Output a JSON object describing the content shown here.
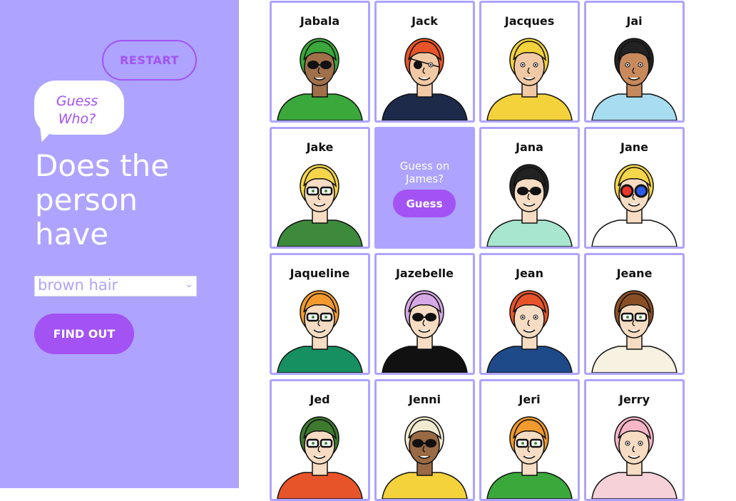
{
  "sidebar": {
    "restart_label": "RESTART",
    "bubble_line1": "Guess",
    "bubble_line2": "Who?",
    "question_line1": "Does the",
    "question_line2": "person",
    "question_line3": "have",
    "select_value": "brown hair",
    "find_out_label": "FIND OUT"
  },
  "colors": {
    "sidebar_bg": "#aea4ff",
    "accent": "#a352f4",
    "card_border": "#aea4ff"
  },
  "guess_card": {
    "line1": "Guess on",
    "line2": "James?",
    "button_label": "Guess"
  },
  "cards": [
    {
      "name": "Jabala",
      "skin": "#a0704a",
      "hair": "#3aa83a",
      "shirt": "#3aa83a",
      "glasses": "sun"
    },
    {
      "name": "Jack",
      "skin": "#f1c9a5",
      "hair": "#e8542a",
      "shirt": "#1e2a4a",
      "glasses": "patch"
    },
    {
      "name": "Jacques",
      "skin": "#f1c9a5",
      "hair": "#f4d23c",
      "shirt": "#f4d23c",
      "glasses": "none"
    },
    {
      "name": "Jai",
      "skin": "#c8895d",
      "hair": "#222222",
      "shirt": "#a8dcf0",
      "glasses": "none"
    },
    {
      "name": "Jake",
      "skin": "#f6dcc2",
      "hair": "#f5d54a",
      "shirt": "#3d8a3d",
      "glasses": "clear"
    },
    {
      "name": "GUESS"
    },
    {
      "name": "Jana",
      "skin": "#f6dcc2",
      "hair": "#222222",
      "shirt": "#a8e6d0",
      "glasses": "sun"
    },
    {
      "name": "Jane",
      "skin": "#f6dcc2",
      "hair": "#f5d54a",
      "shirt": "#ffffff",
      "glasses": "color"
    },
    {
      "name": "Jaqueline",
      "skin": "#f6dcc2",
      "hair": "#f29a2e",
      "shirt": "#169060",
      "glasses": "clear"
    },
    {
      "name": "Jazebelle",
      "skin": "#f6dcc2",
      "hair": "#d6a9e6",
      "shirt": "#111111",
      "glasses": "sun"
    },
    {
      "name": "Jean",
      "skin": "#f6dcc2",
      "hair": "#e8542a",
      "shirt": "#1e4a8a",
      "glasses": "none"
    },
    {
      "name": "Jeane",
      "skin": "#f6dcc2",
      "hair": "#8a4f25",
      "shirt": "#f6f1e0",
      "glasses": "clear"
    },
    {
      "name": "Jed",
      "skin": "#f6dcc2",
      "hair": "#3d7a2d",
      "shirt": "#e8542a",
      "glasses": "clear"
    },
    {
      "name": "Jenni",
      "skin": "#9a6a45",
      "hair": "#f2ead0",
      "shirt": "#f4d23c",
      "glasses": "sun"
    },
    {
      "name": "Jeri",
      "skin": "#f6dcc2",
      "hair": "#f29a2e",
      "shirt": "#3aa83a",
      "glasses": "clear"
    },
    {
      "name": "Jerry",
      "skin": "#f6dcc2",
      "hair": "#f6b6c8",
      "shirt": "#f6d2d8",
      "glasses": "none"
    }
  ]
}
